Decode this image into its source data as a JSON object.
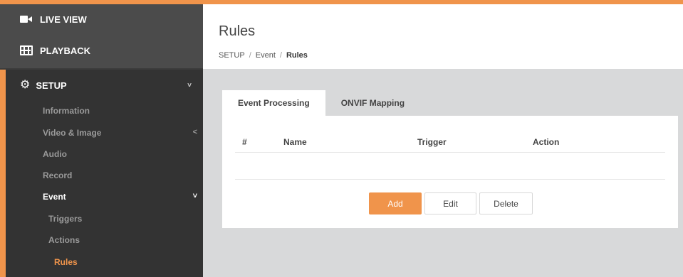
{
  "colors": {
    "accent": "#f0944b",
    "sidebar_bg": "#3c3c3c",
    "content_bg": "#d8d9da"
  },
  "nav": {
    "live_view": {
      "label": "LIVE VIEW",
      "icon": "video-camera-icon"
    },
    "playback": {
      "label": "PLAYBACK",
      "icon": "film-icon"
    },
    "setup": {
      "label": "SETUP",
      "icon": "gears-icon",
      "chevron": "˅"
    },
    "setup_items": [
      {
        "label": "Information"
      },
      {
        "label": "Video & Image",
        "chevron": "<"
      },
      {
        "label": "Audio"
      },
      {
        "label": "Record"
      },
      {
        "label": "Event",
        "chevron": "˅"
      }
    ],
    "event_items": [
      {
        "label": "Triggers"
      },
      {
        "label": "Actions"
      },
      {
        "label": "Rules"
      }
    ]
  },
  "header": {
    "title": "Rules",
    "breadcrumb": [
      "SETUP",
      "Event",
      "Rules"
    ],
    "separator": "/"
  },
  "tabs": [
    {
      "label": "Event Processing",
      "active": true
    },
    {
      "label": "ONVIF Mapping",
      "active": false
    }
  ],
  "table": {
    "columns": [
      "#",
      "Name",
      "Trigger",
      "Action"
    ],
    "rows": []
  },
  "buttons": {
    "add": "Add",
    "edit": "Edit",
    "delete": "Delete"
  }
}
